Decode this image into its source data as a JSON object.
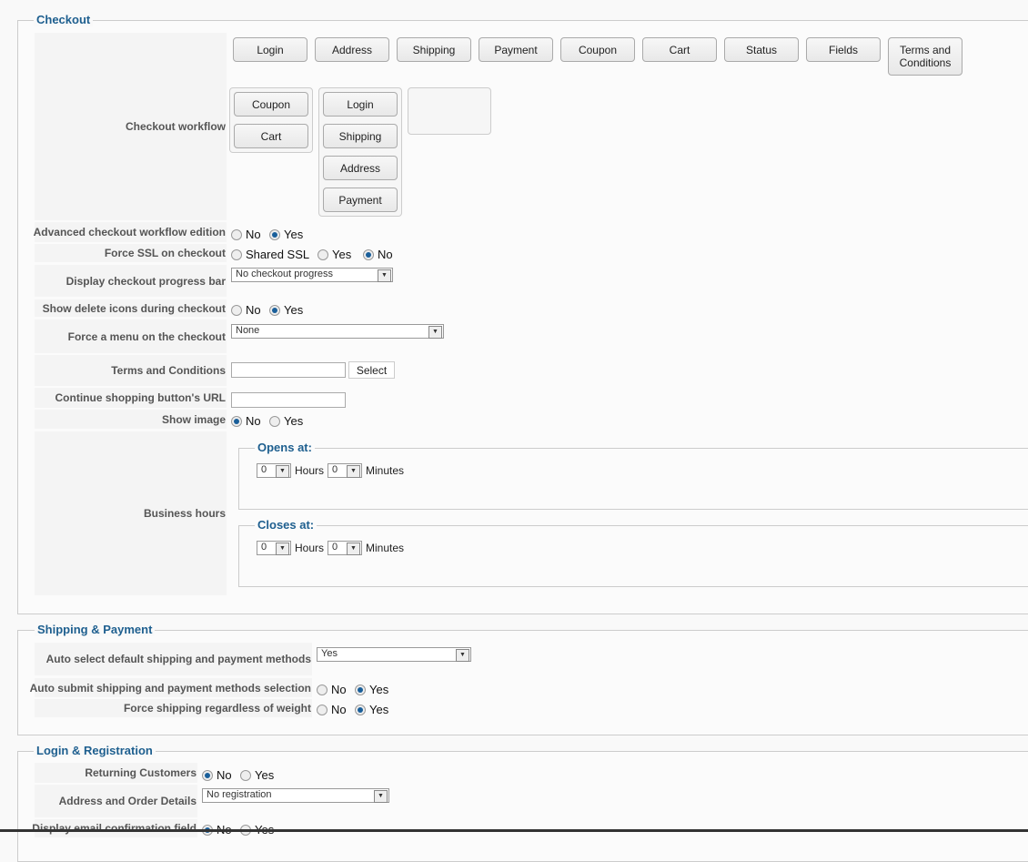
{
  "checkout": {
    "legend": "Checkout",
    "workflow_label": "Checkout workflow",
    "available_steps": [
      "Login",
      "Address",
      "Shipping",
      "Payment",
      "Coupon",
      "Cart",
      "Status",
      "Fields",
      "Terms and Conditions"
    ],
    "step_group_1": [
      "Coupon",
      "Cart"
    ],
    "step_group_2": [
      "Login",
      "Shipping",
      "Address",
      "Payment"
    ],
    "advanced_label": "Advanced checkout workflow edition",
    "ssl_label": "Force SSL on checkout",
    "progress_label": "Display checkout progress bar",
    "progress_value": "No checkout progress",
    "delete_label": "Show delete icons during checkout",
    "menu_label": "Force a menu on the checkout",
    "menu_value": "None",
    "terms_label": "Terms and Conditions",
    "terms_value": "",
    "select_button": "Select",
    "continue_label": "Continue shopping button's URL",
    "continue_value": "",
    "image_label": "Show image",
    "hours_label": "Business hours",
    "opens_legend": "Opens at:",
    "closes_legend": "Closes at:",
    "opens_hours": "0",
    "opens_minutes": "0",
    "closes_hours": "0",
    "closes_minutes": "0",
    "hours_text": "Hours",
    "minutes_text": "Minutes"
  },
  "options": {
    "no": "No",
    "yes": "Yes",
    "shared_ssl": "Shared SSL"
  },
  "shipping": {
    "legend": "Shipping & Payment",
    "auto_select_label": "Auto select default shipping and payment methods",
    "auto_select_value": "Yes",
    "auto_submit_label": "Auto submit shipping and payment methods selection",
    "force_label": "Force shipping regardless of weight"
  },
  "login": {
    "legend": "Login & Registration",
    "returning_label": "Returning Customers",
    "address_label": "Address and Order Details",
    "address_value": "No registration",
    "email_label": "Display email confirmation field"
  }
}
